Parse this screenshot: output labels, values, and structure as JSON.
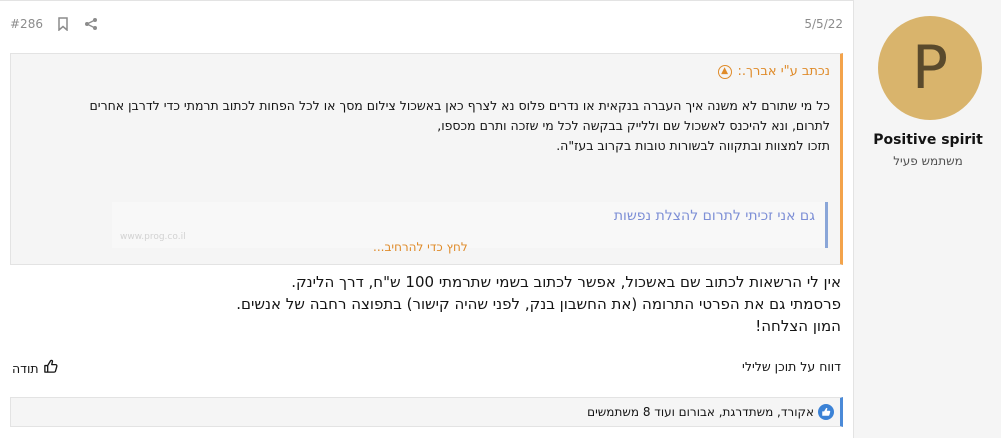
{
  "post": {
    "number": "#286",
    "date": "5/5/22"
  },
  "user": {
    "avatar_letter": "P",
    "name": "Positive spirit",
    "title": "משתמש פעיל"
  },
  "quote": {
    "title": "נכתב ע\"י אברך.:",
    "lines": [
      "כל מי שתורם לא משנה איך העברה בנקאית או נדרים פלוס נא לצרף כאן באשכול צילום מסך או לכל הפחות לכתוב תרמתי כדי לדרבן אחרים",
      "לתרום, ונא להיכנס לאשכול שם וללייק בבקשה לכל מי שזכה ותרם מכספו,",
      "תזכו למצוות ובתקווה לבשורות טובות בקרוב בעז\"ה."
    ],
    "embed_title": "גם אני זכיתי לתרום להצלת נפשות",
    "embed_site": "www.prog.co.il",
    "expand": "לחץ כדי להרחיב..."
  },
  "body": {
    "lines": [
      "אין לי הרשאות לכתוב שם באשכול, אפשר לכתוב בשמי שתרמתי 100 ש\"ח, דרך הלינק.",
      "פרסמתי גם את הפרטי התרומה (את החשבון בנק, לפני שהיה קישור) בתפוצה רחבה של אנשים.",
      "המון הצלחה!"
    ]
  },
  "actions": {
    "report": "דווח על תוכן שלילי",
    "like": "תודה"
  },
  "likes": {
    "text": "אקורד, משתדרגת, אבורום ועוד 8 משתמשים"
  },
  "colors": {
    "accent": "#df8b2a",
    "avatar_bg": "#d9b46c",
    "like_blue": "#3b82d6"
  }
}
